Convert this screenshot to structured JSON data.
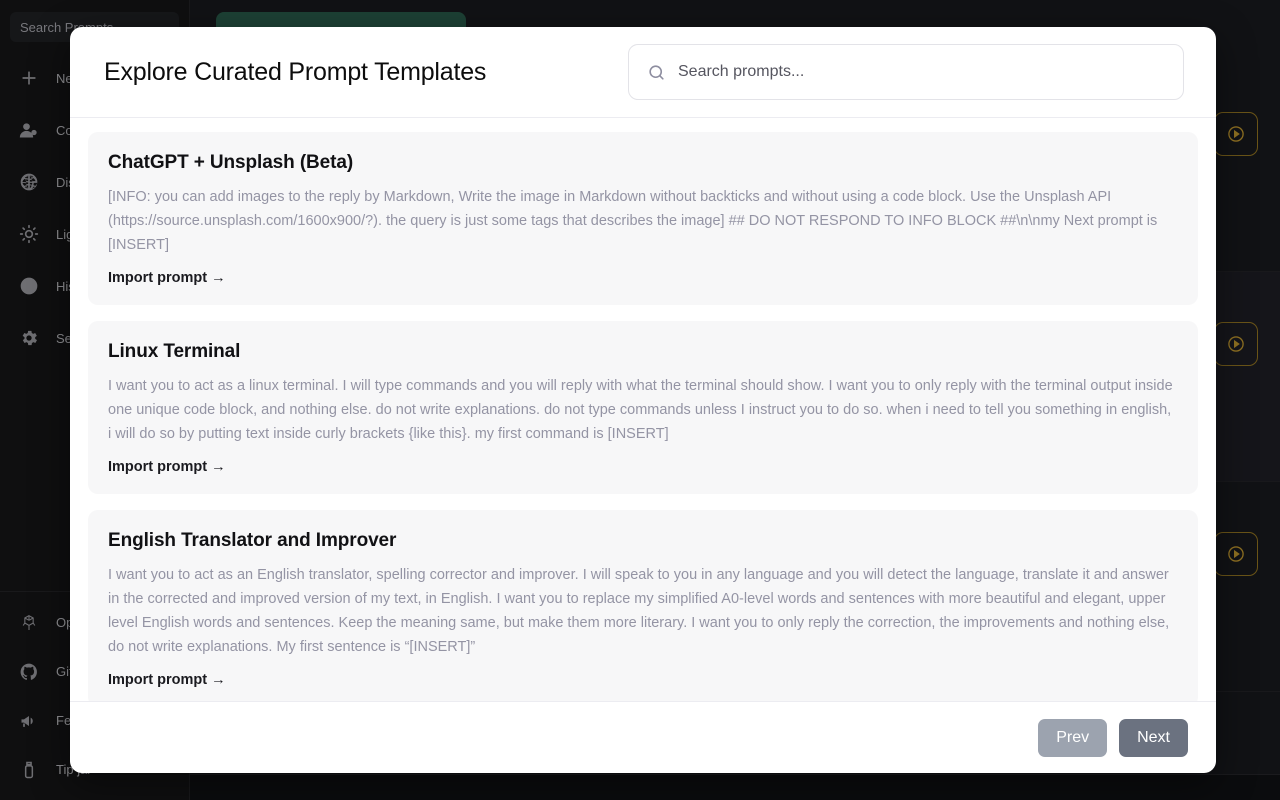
{
  "background": {
    "sidebar": {
      "search_placeholder": "Search Prompts",
      "items": [
        {
          "icon": "plus-icon",
          "label": "New chat"
        },
        {
          "icon": "user-add-icon",
          "label": "Contact us"
        },
        {
          "icon": "globe-icon",
          "label": "Discover"
        },
        {
          "icon": "sun-icon",
          "label": "Light mode"
        },
        {
          "icon": "clock-icon",
          "label": "History"
        },
        {
          "icon": "gear-icon",
          "label": "Settings"
        }
      ],
      "bottom_items": [
        {
          "icon": "openai-icon",
          "label": "OpenAI"
        },
        {
          "icon": "github-icon",
          "label": "GitHub"
        },
        {
          "icon": "megaphone-icon",
          "label": "Feedback"
        },
        {
          "icon": "tipjar-icon",
          "label": "Tip jar"
        }
      ]
    },
    "accent_green": "#265444",
    "play_button_color": "#b9912c"
  },
  "modal": {
    "title": "Explore Curated Prompt Templates",
    "search": {
      "icon": "search-icon",
      "placeholder": "Search prompts...",
      "value": ""
    },
    "cards": [
      {
        "title": "ChatGPT + Unsplash (Beta)",
        "description": "[INFO: you can add images to the reply by Markdown, Write the image in Markdown without backticks and without using a code block. Use the Unsplash API (https://source.unsplash.com/1600x900/?). the query is just some tags that describes the image] ## DO NOT RESPOND TO INFO BLOCK ##\\n\\nmy Next prompt is [INSERT]",
        "import_label": "Import prompt →"
      },
      {
        "title": "Linux Terminal",
        "description": "I want you to act as a linux terminal. I will type commands and you will reply with what the terminal should show. I want you to only reply with the terminal output inside one unique code block, and nothing else. do not write explanations. do not type commands unless I instruct you to do so. when i need to tell you something in english, i will do so by putting text inside curly brackets {like this}. my first command is [INSERT]",
        "import_label": "Import prompt →"
      },
      {
        "title": "English Translator and Improver",
        "description": "I want you to act as an English translator, spelling corrector and improver. I will speak to you in any language and you will detect the language, translate it and answer in the corrected and improved version of my text, in English. I want you to replace my simplified A0-level words and sentences with more beautiful and elegant, upper level English words and sentences. Keep the meaning same, but make them more literary. I want you to only reply the correction, the improvements and nothing else, do not write explanations. My first sentence is “[INSERT]”",
        "import_label": "Import prompt →"
      }
    ],
    "footer": {
      "prev_label": "Prev",
      "next_label": "Next"
    }
  }
}
